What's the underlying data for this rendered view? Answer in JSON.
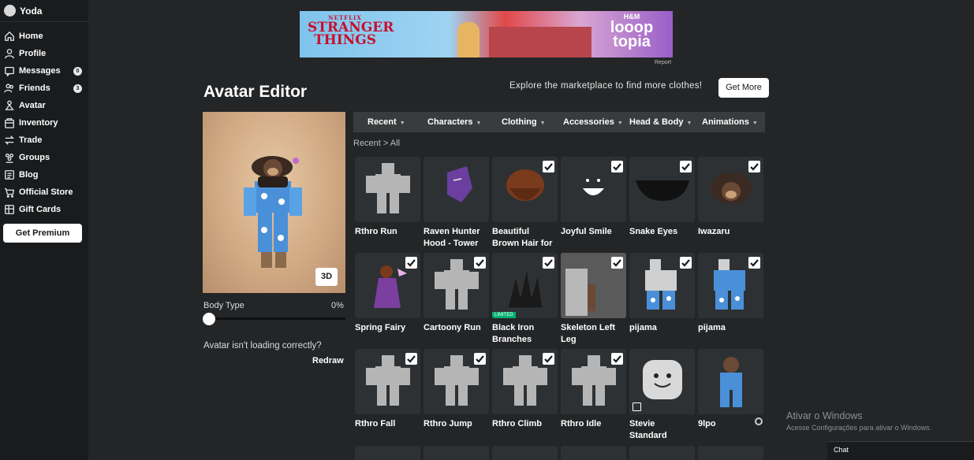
{
  "user": {
    "name": "Yoda"
  },
  "nav": [
    {
      "label": "Home",
      "icon": "home-icon"
    },
    {
      "label": "Profile",
      "icon": "profile-icon"
    },
    {
      "label": "Messages",
      "icon": "messages-icon",
      "badge": "0"
    },
    {
      "label": "Friends",
      "icon": "friends-icon",
      "badge": "3"
    },
    {
      "label": "Avatar",
      "icon": "avatar-icon"
    },
    {
      "label": "Inventory",
      "icon": "inventory-icon"
    },
    {
      "label": "Trade",
      "icon": "trade-icon"
    },
    {
      "label": "Groups",
      "icon": "groups-icon"
    },
    {
      "label": "Blog",
      "icon": "blog-icon"
    },
    {
      "label": "Official Store",
      "icon": "store-icon"
    },
    {
      "label": "Gift Cards",
      "icon": "gift-card-icon"
    }
  ],
  "premium_label": "Get Premium",
  "ad": {
    "netflix": "NETFLIX",
    "stranger": "STRANGER",
    "things": "THINGS",
    "hm": "H&M",
    "looop": "looop",
    "topia": "topia",
    "report": "Report"
  },
  "header": {
    "title": "Avatar Editor",
    "explore": "Explore the marketplace to find more clothes!",
    "get_more": "Get More"
  },
  "preview": {
    "btn3d": "3D",
    "body_type_label": "Body Type",
    "body_type_value": "0%",
    "body_type_level": 0,
    "loading_question": "Avatar isn't loading correctly?",
    "redraw": "Redraw"
  },
  "tabs": [
    "Recent",
    "Characters",
    "Clothing",
    "Accessories",
    "Head & Body",
    "Animations"
  ],
  "breadcrumb": "Recent > All",
  "items": [
    {
      "name": "Rthro Run",
      "checked": false
    },
    {
      "name": "Raven Hunter Hood - Tower",
      "checked": false
    },
    {
      "name": "Beautiful Brown Hair for",
      "checked": true
    },
    {
      "name": "Joyful Smile",
      "checked": true
    },
    {
      "name": "Snake Eyes",
      "checked": true
    },
    {
      "name": "Iwazaru",
      "checked": true
    },
    {
      "name": "Spring Fairy",
      "checked": true
    },
    {
      "name": "Cartoony Run",
      "checked": true
    },
    {
      "name": "Black Iron Branches",
      "checked": true,
      "limited": "LIMITED"
    },
    {
      "name": "Skeleton Left Leg",
      "checked": true
    },
    {
      "name": "pijama",
      "checked": true
    },
    {
      "name": "pijama",
      "checked": true
    },
    {
      "name": "Rthro Fall",
      "checked": true
    },
    {
      "name": "Rthro Jump",
      "checked": true
    },
    {
      "name": "Rthro Climb",
      "checked": true
    },
    {
      "name": "Rthro Idle",
      "checked": true
    },
    {
      "name": "Stevie Standard",
      "checked": false
    },
    {
      "name": "9lpo",
      "checked": false
    }
  ],
  "watermark": {
    "line1": "Ativar o Windows",
    "line2": "Acesse Configurações para ativar o Windows."
  },
  "chat_label": "Chat"
}
